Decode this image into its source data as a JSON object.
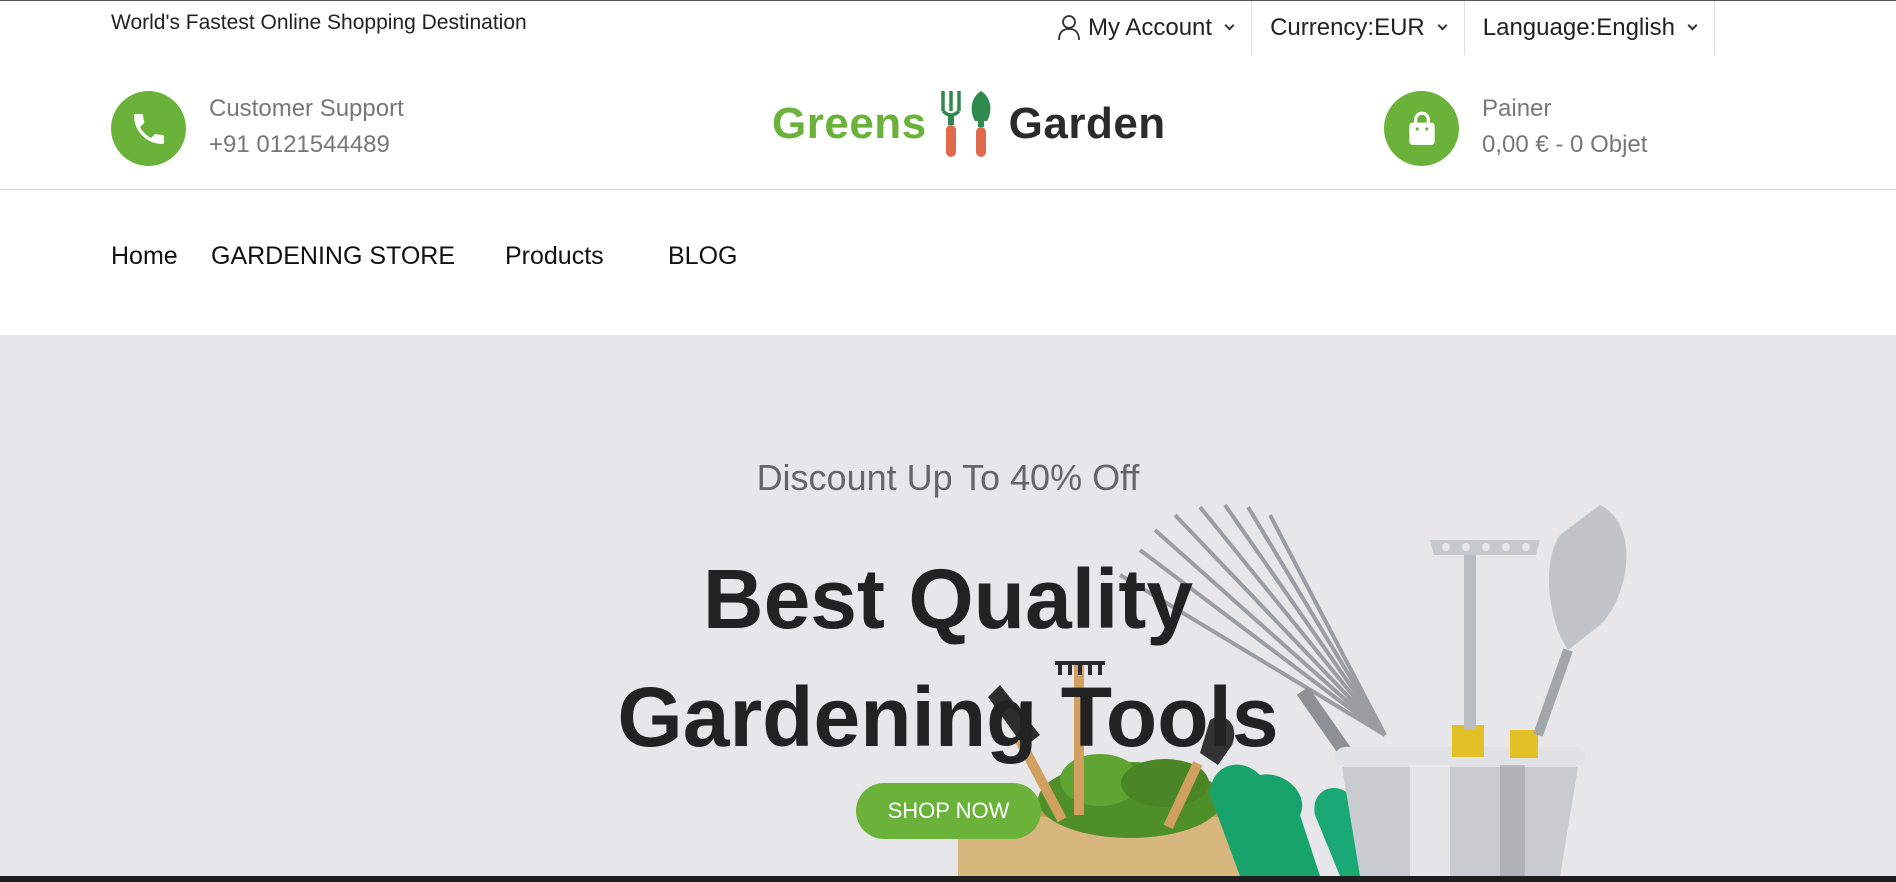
{
  "topbar": {
    "tagline": "World's Fastest Online Shopping Destination",
    "account_label": "My Account",
    "currency_label": "Currency:EUR",
    "language_label": "Language:English"
  },
  "header": {
    "support_title": "Customer Support",
    "support_phone": "+91 0121544489",
    "logo_word_1": "Greens",
    "logo_word_2": "Garden",
    "cart_title": "Painer",
    "cart_summary": "0,00 € - 0 Objet"
  },
  "nav": {
    "items": [
      "Home",
      "GARDENING STORE",
      "Products",
      "BLOG"
    ]
  },
  "hero": {
    "subtitle": "Discount Up To 40% Off",
    "title_line_1": "Best Quality",
    "title_line_2": "Gardening Tools",
    "button_label": "SHOP NOW"
  },
  "colors": {
    "accent": "#6ab23a",
    "hero_bg": "#e7e7e9",
    "text_dark": "#222222",
    "text_muted": "#777777"
  },
  "icons": {
    "account": "user-icon",
    "support": "phone-icon",
    "cart": "shopping-bag-icon",
    "dropdown": "chevron-down-icon"
  }
}
